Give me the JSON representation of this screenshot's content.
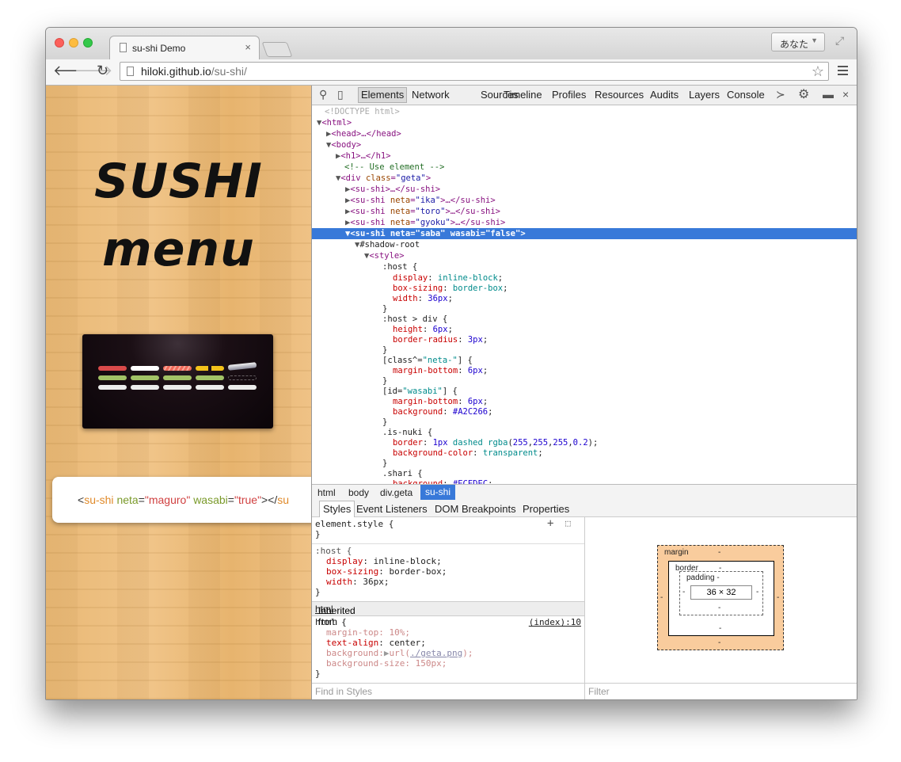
{
  "browser": {
    "tab_title": "su-shi Demo",
    "tab_close": "×",
    "profile": "あなた",
    "url_host": "hiloki.github.io",
    "url_path": "/su-shi/"
  },
  "page": {
    "heading_line1": "SUSHI",
    "heading_line2": "menu",
    "code_tag_open": "<",
    "code_tag": "su-shi",
    "code_attr1": "neta",
    "code_val1": "\"maguro\"",
    "code_attr2": "wasabi",
    "code_val2": "\"true\"",
    "code_close": "></",
    "code_tag_end": "su"
  },
  "devtools": {
    "tabs": [
      "Elements",
      "Network",
      "Sources",
      "Timeline",
      "Profiles",
      "Resources",
      "Audits",
      "Layers",
      "Console"
    ],
    "dom_lines": {
      "doctype": "<!DOCTYPE html>",
      "html": "<html>",
      "head": "<head>…</head>",
      "body": "<body>",
      "h1": "<h1>…</h1>",
      "comment": "<!-- Use element -->",
      "div_open": "<div ",
      "div_attr": "class",
      "div_val": "\"geta\"",
      "sushi1": "<su-shi>…</su-shi>",
      "ika": "\"ika\"",
      "toro": "\"toro\"",
      "gyoku": "\"gyoku\"",
      "saba": "\"saba\"",
      "false": "\"false\"",
      "shadow_root": "#shadow-root",
      "style": "<style>"
    },
    "breadcrumbs": [
      "html",
      "body",
      "div.geta",
      "su-shi"
    ],
    "sub_tabs": [
      "Styles",
      "Event Listeners",
      "DOM Breakpoints",
      "Properties"
    ],
    "styles": {
      "element_style": "element.style {",
      "close": "}",
      "host_selector": ":host {",
      "inherited_label": "Inherited from ",
      "inherited_link": "html",
      "html_selector": "html {",
      "source_link": "(index):10",
      "find_placeholder": "Find in Styles"
    },
    "metrics": {
      "margin": "margin",
      "border": "border",
      "padding": "padding -",
      "content": "36 × 32",
      "dash": "-",
      "filter_placeholder": "Filter"
    }
  },
  "colors": {
    "selection": "#3879d9",
    "wasabi": "#A2C266",
    "shari": "#ECEDEC",
    "maguro": "#d94a4a",
    "ika": "#ffffff",
    "toro": "#f28a7a",
    "gyoku": "#f3c21a"
  }
}
